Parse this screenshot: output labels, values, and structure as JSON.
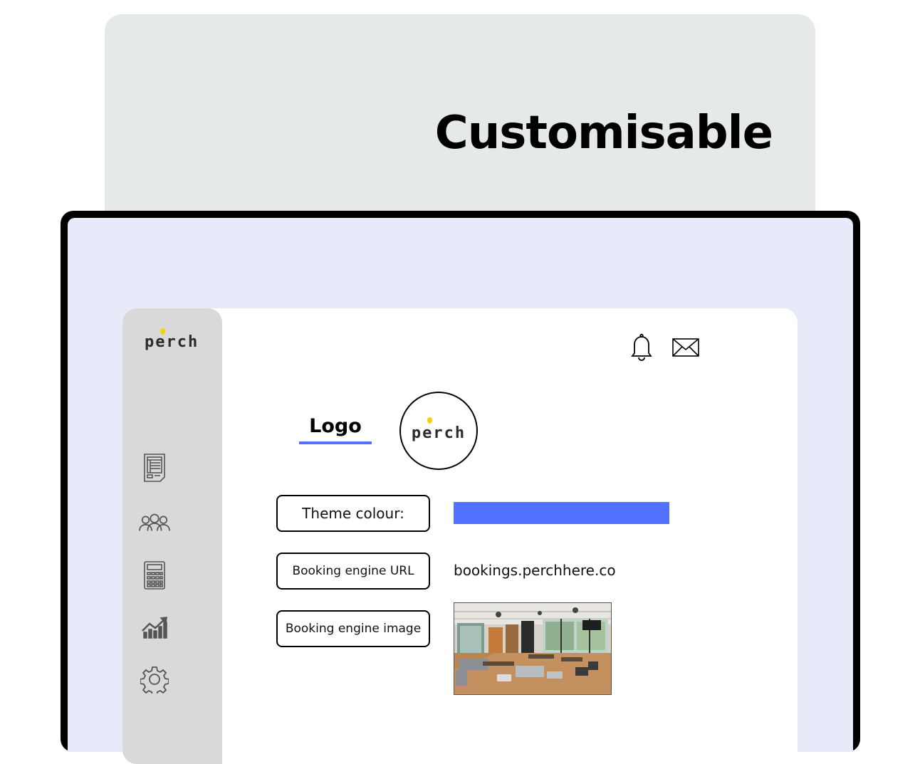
{
  "headline": "Customisable",
  "brand": {
    "name": "perch",
    "dot_color": "#f4d20a"
  },
  "sidebar": {
    "items": [
      {
        "icon": "document-icon"
      },
      {
        "icon": "users-icon"
      },
      {
        "icon": "calculator-icon"
      },
      {
        "icon": "analytics-icon"
      },
      {
        "icon": "gear-icon"
      }
    ]
  },
  "topbar": {
    "icons": [
      "bell-icon",
      "mail-icon"
    ]
  },
  "logo_section": {
    "tab_label": "Logo",
    "preview_text": "perch"
  },
  "settings": {
    "theme": {
      "label": "Theme colour:",
      "color": "#5271ff"
    },
    "url": {
      "label": "Booking engine URL",
      "value": "bookings.perchhere.co"
    },
    "image": {
      "label": "Booking engine image"
    }
  },
  "colors": {
    "accent": "#5271ff",
    "screen_bg": "#e7eaf8",
    "sidebar_bg": "#d9d9d9",
    "card_bg": "#e6e9ea"
  }
}
